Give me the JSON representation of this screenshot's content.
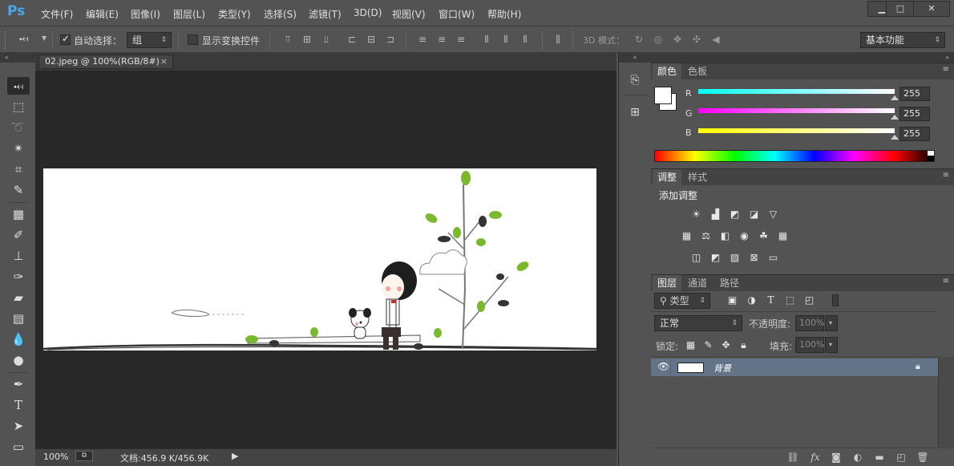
{
  "app": {
    "logo": "Ps"
  },
  "menu": [
    "文件(F)",
    "编辑(E)",
    "图像(I)",
    "图层(L)",
    "类型(Y)",
    "选择(S)",
    "滤镜(T)",
    "3D(D)",
    "视图(V)",
    "窗口(W)",
    "帮助(H)"
  ],
  "window_controls": {
    "minimize": "▁",
    "maximize": "□",
    "close": "✕"
  },
  "options": {
    "auto_select_label": "自动选择：",
    "auto_select_checked": true,
    "auto_select_value": "组",
    "show_transform_label": "显示变换控件",
    "three_d_mode_label": "3D 模式：",
    "workspace": "基本功能"
  },
  "document": {
    "tab_title": "02.jpeg @ 100%(RGB/8#)",
    "tab_close": "×"
  },
  "status": {
    "zoom": "100%",
    "doc_info": "文档:456.9 K/456.9K"
  },
  "color_panel": {
    "tabs": [
      "颜色",
      "色板"
    ],
    "channels": [
      {
        "label": "R",
        "value": "255",
        "color": "#00ffff"
      },
      {
        "label": "G",
        "value": "255",
        "color": "#ff00ff"
      },
      {
        "label": "B",
        "value": "255",
        "color": "#ffff00"
      }
    ]
  },
  "adjustments_panel": {
    "tabs": [
      "调整",
      "样式"
    ],
    "heading": "添加调整"
  },
  "layers_panel": {
    "tabs": [
      "图层",
      "通道",
      "路径"
    ],
    "filter_kind": "类型",
    "blend_mode": "正常",
    "opacity_label": "不透明度:",
    "opacity_value": "100%",
    "lock_label": "锁定:",
    "fill_label": "填充:",
    "fill_value": "100%",
    "layer_name": "背景",
    "layer_selected_color": "#637489"
  }
}
